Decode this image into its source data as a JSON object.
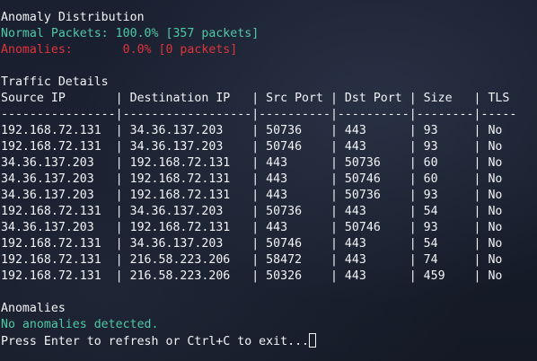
{
  "distribution": {
    "title": "Anomaly Distribution",
    "normal": "Normal Packets: 100.0% [357 packets]",
    "anomalies": "Anomalies:       0.0% [0 packets]"
  },
  "traffic": {
    "title": "Traffic Details",
    "header": "Source IP       | Destination IP   | Src Port | Dst Port | Size   | TLS",
    "separator": "----------------|------------------|----------|----------|--------|-----",
    "rows": [
      "192.168.72.131  | 34.36.137.203    | 50736    | 443      | 93     | No",
      "192.168.72.131  | 34.36.137.203    | 50746    | 443      | 93     | No",
      "34.36.137.203   | 192.168.72.131   | 443      | 50736    | 60     | No",
      "34.36.137.203   | 192.168.72.131   | 443      | 50746    | 60     | No",
      "34.36.137.203   | 192.168.72.131   | 443      | 50736    | 93     | No",
      "192.168.72.131  | 34.36.137.203    | 50736    | 443      | 54     | No",
      "34.36.137.203   | 192.168.72.131   | 443      | 50746    | 93     | No",
      "192.168.72.131  | 34.36.137.203    | 50746    | 443      | 54     | No",
      "192.168.72.131  | 216.58.223.206   | 58472    | 443      | 74     | No",
      "192.168.72.131  | 216.58.223.206   | 50326    | 443      | 459    | No"
    ]
  },
  "anomalies_section": {
    "title": "Anomalies",
    "message": "No anomalies detected."
  },
  "prompt": {
    "text": "Press Enter to refresh or Ctrl+C to exit..."
  }
}
